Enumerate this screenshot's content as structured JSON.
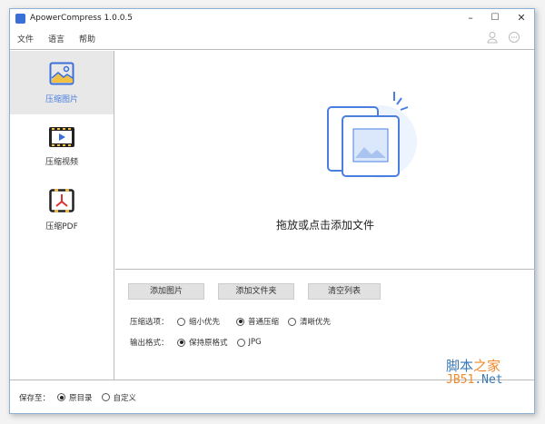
{
  "window": {
    "title": "ApowerCompress 1.0.0.5",
    "minimize": "–",
    "maximize": "☐",
    "close": "✕"
  },
  "menu": [
    "文件",
    "语言",
    "帮助"
  ],
  "sidebar": [
    {
      "label": "压缩图片",
      "active": true
    },
    {
      "label": "压缩视频"
    },
    {
      "label": "压缩PDF"
    }
  ],
  "dropzone": {
    "text": "拖放或点击添加文件"
  },
  "buttons": {
    "add_images": "添加图片",
    "add_folder": "添加文件夹",
    "clear_list": "清空列表"
  },
  "compress": {
    "label": "压缩选项：",
    "options": [
      "缩小优先",
      "普通压缩",
      "清晰优先"
    ],
    "selected": 1
  },
  "format": {
    "label": "输出格式：",
    "options": [
      "保持原格式",
      "JPG"
    ],
    "selected": 0
  },
  "save": {
    "label": "保存至：",
    "options": [
      "原目录",
      "自定义"
    ],
    "selected": 0
  },
  "watermark": {
    "line1a": "脚本",
    "line1b": "之家",
    "line2a": "JB51",
    "line2b": ".Net"
  },
  "colors": {
    "accent": "#4a7fe0"
  }
}
